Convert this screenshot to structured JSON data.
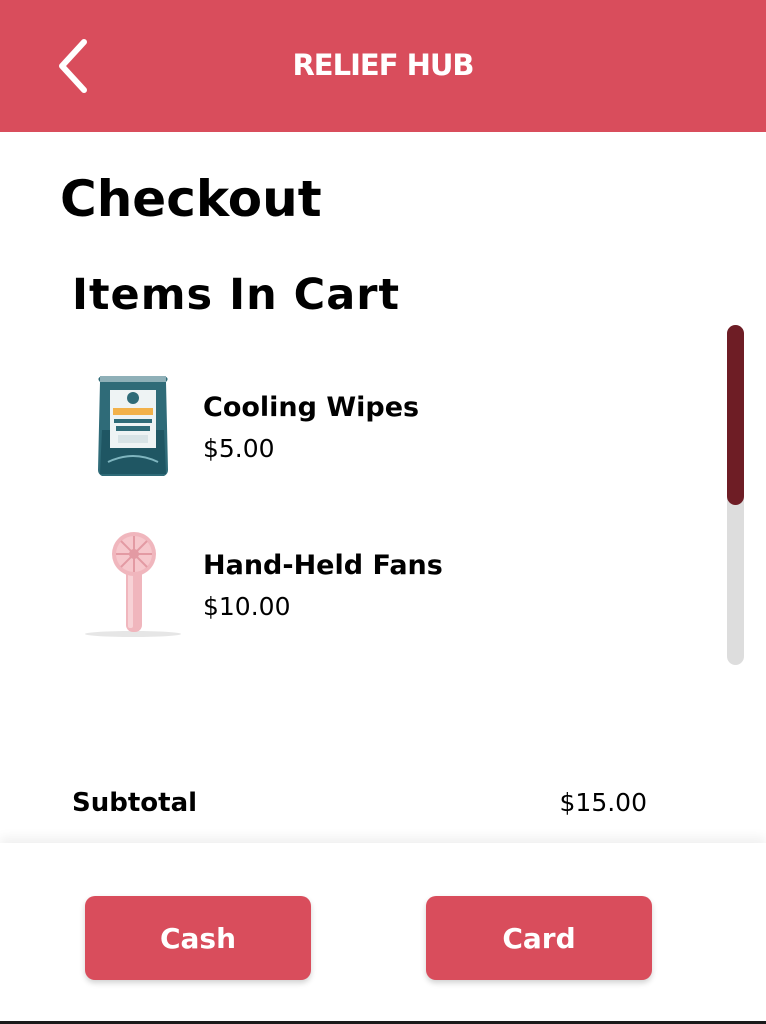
{
  "header": {
    "title": "RELIEF HUB",
    "back_icon": "chevron-left-icon",
    "background_color": "#d94d5c"
  },
  "page": {
    "title": "Checkout"
  },
  "cart": {
    "heading": "Items In Cart",
    "items": [
      {
        "name": "Cooling Wipes",
        "price": "$5.00",
        "image_icon": "body-wipes-pack-icon"
      },
      {
        "name": "Hand-Held Fans",
        "price": "$10.00",
        "image_icon": "handheld-fan-icon"
      }
    ]
  },
  "summary": {
    "subtotal_label": "Subtotal",
    "subtotal_value": "$15.00"
  },
  "actions": {
    "cash_label": "Cash",
    "card_label": "Card",
    "button_color": "#d94d5c"
  },
  "scrollbar": {
    "thumb_color": "#6e1d25",
    "track_color": "#dddddd"
  }
}
